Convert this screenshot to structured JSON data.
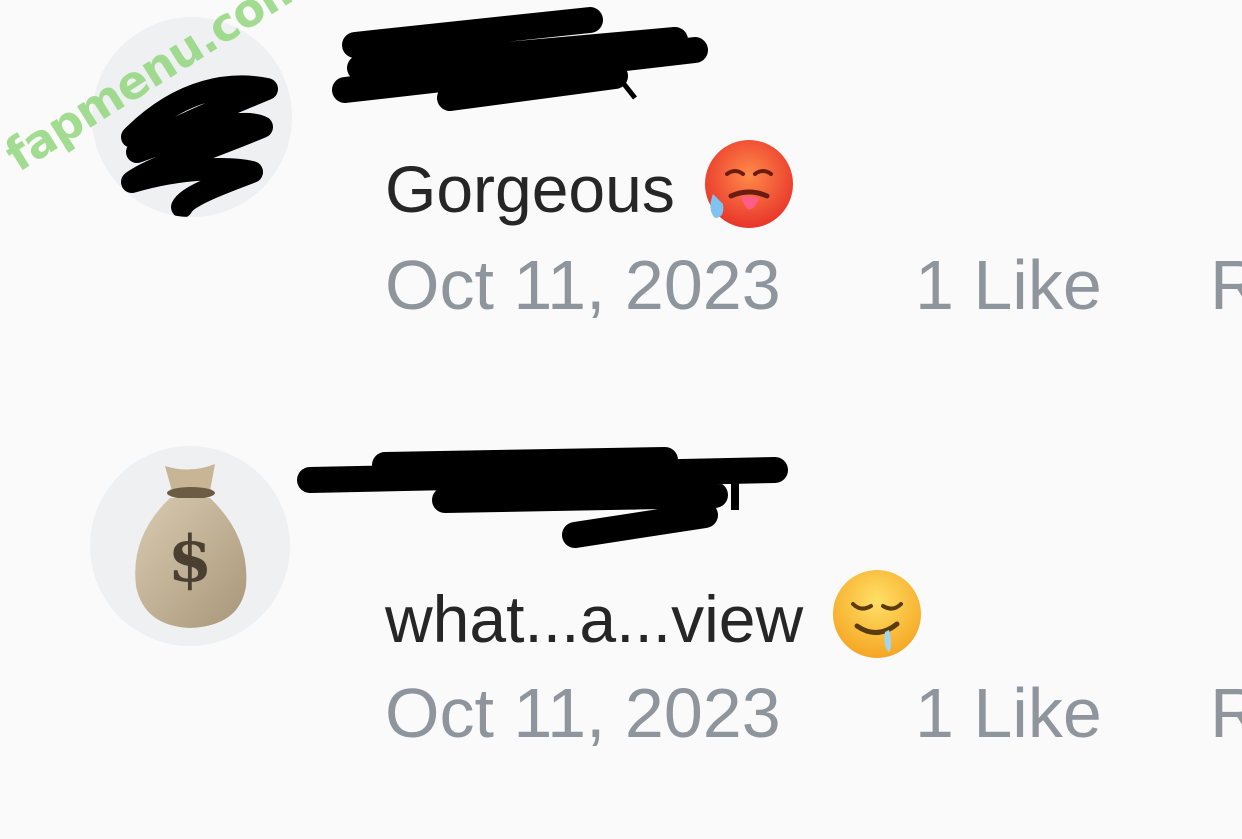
{
  "comments": [
    {
      "text": "Gorgeous",
      "emoji": "hot-face-emoji",
      "date": "Oct 11, 2023",
      "likes": "1 Like",
      "reply": "Reply"
    },
    {
      "text": "what...a...view",
      "emoji": "drooling-face-emoji",
      "date": "Oct 11, 2023",
      "likes": "1 Like",
      "reply": "Reply"
    }
  ],
  "watermark": "fapmenu.com",
  "colors": {
    "background": "#fafafa",
    "comment_text": "#262626",
    "meta_text": "#8e959c",
    "avatar_bg": "#eef0f1",
    "watermark": "#90d67e"
  }
}
